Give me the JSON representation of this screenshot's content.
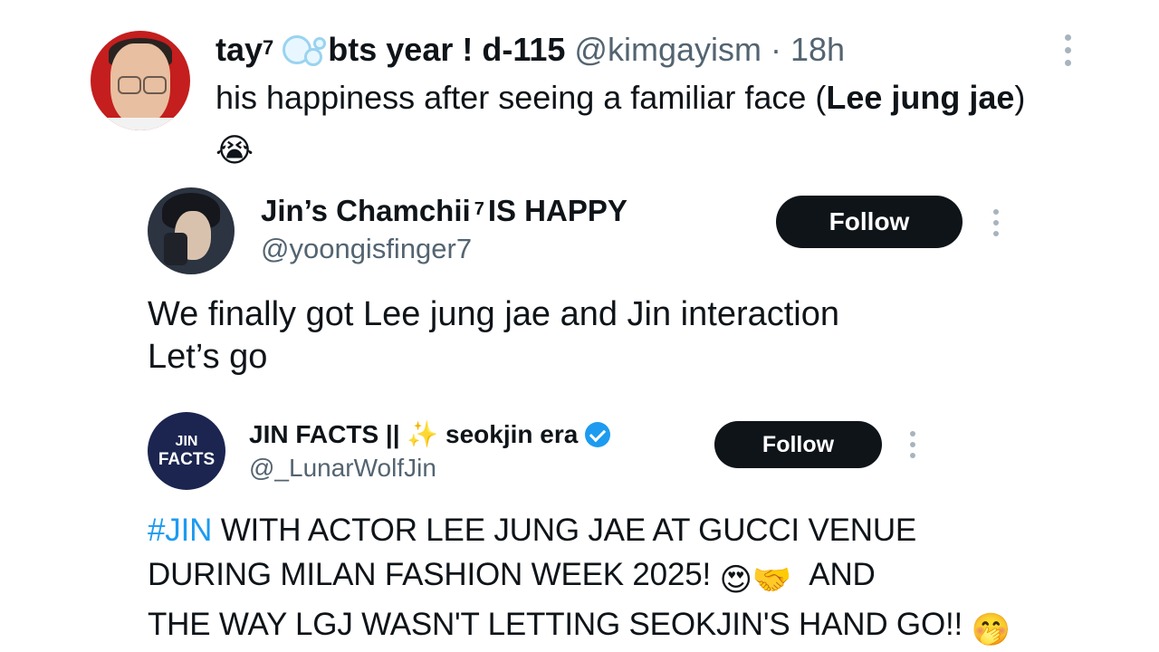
{
  "outer_tweet": {
    "display_name_prefix": "tay",
    "superscript": "7",
    "display_name_suffix": "bts year ! d-115",
    "handle": "@kimgayism",
    "separator": "·",
    "time": "18h",
    "text_before_bold": "his happiness after seeing a familiar face (",
    "text_bold": "Lee jung jae",
    "text_after_bold": ")",
    "emoji": "😭",
    "bubble_icon": "bubbles-emoji",
    "menu_icon": "more-vertical-icon"
  },
  "quote_1": {
    "display_name_prefix": "Jin’s Chamchii",
    "superscript": "7",
    "display_name_suffix": "IS HAPPY",
    "handle": "@yoongisfinger7",
    "follow_label": "Follow",
    "text_line1": "We finally got Lee jung jae and Jin interaction",
    "text_line2": "Let’s go"
  },
  "quote_2": {
    "display_name_prefix": "JIN FACTS ||",
    "sparkle": "✨",
    "display_name_suffix": "seokjin era",
    "verified_icon": "verified-badge-icon",
    "handle": "@_LunarWolfJin",
    "follow_label": "Follow",
    "avatar_line1": "JIN",
    "avatar_line2": "FACTS",
    "hashtag": "#JIN",
    "text_line1_rest": " WITH ACTOR LEE JUNG JAE AT GUCCI VENUE",
    "text_line2": "DURING MILAN FASHION WEEK 2025!",
    "emoji_heart_eyes": "😍",
    "emoji_handshake": "🤝",
    "text_line2_end": "AND",
    "text_line3": "THE WAY LGJ WASN'T LETTING SEOKJIN'S HAND GO!!",
    "emoji_hand_over_mouth": "🤭"
  },
  "colors": {
    "link_blue": "#1d9bf0",
    "text_primary": "#0f1419",
    "text_secondary": "#536471",
    "button_bg": "#0f1419"
  }
}
